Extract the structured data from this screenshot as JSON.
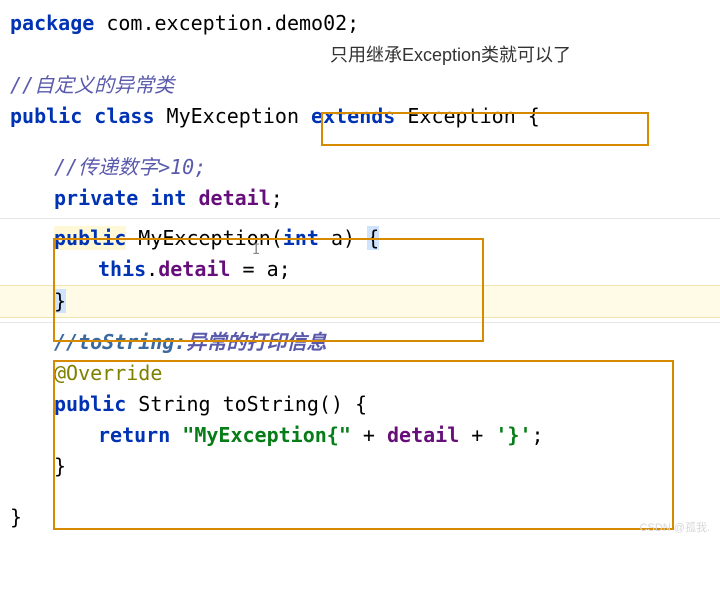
{
  "l1_pkg_kw": "package",
  "l1_pkg_name": " com.exception.demo02;",
  "note_cn": "只用继承Exception类就可以了",
  "c1": "//自定义的异常类",
  "l_pub": "public",
  "l_cls": "class",
  "l_name": " MyException",
  "l_ext": " extends",
  "l_sup": " Exception {",
  "c2": "//传递数字>10;",
  "l_priv": "private",
  "l_int": "int",
  "l_field": "detail",
  "l_semi": ";",
  "ctor_pub": "public",
  "ctor_name": " MyException(",
  "ctor_int": "int",
  "ctor_rest": " a) ",
  "ctor_open": "{",
  "ctor_this": "this",
  "ctor_dot": ".",
  "ctor_fld": "detail",
  "ctor_assign": " = a;",
  "ctor_close": "}",
  "c3a": "//toString:",
  "c3b": "异常的打印信息",
  "anno": "@Override",
  "ts_pub": "public",
  "ts_sig": " String toString() {",
  "ts_ret": "return",
  "ts_str1": "\"MyException{\"",
  "ts_plus1": " + ",
  "ts_fld": "detail",
  "ts_plus2": " + ",
  "ts_str2": "'}'",
  "ts_semi": ";",
  "brace_close": "}",
  "watermark": "CSDN @孤我."
}
